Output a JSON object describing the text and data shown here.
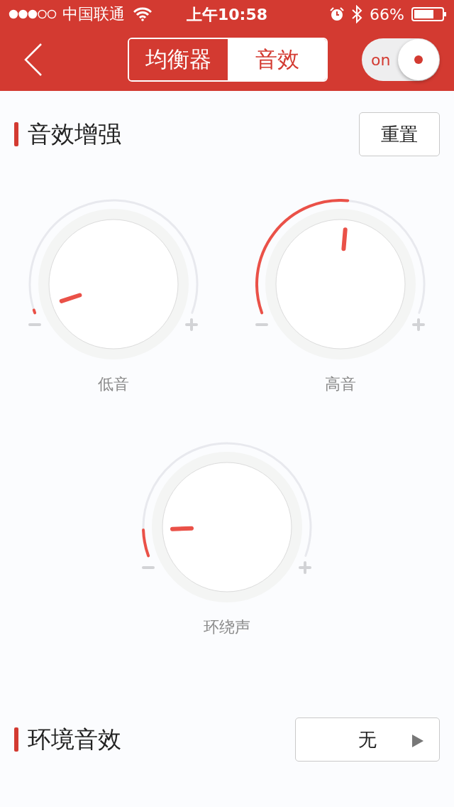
{
  "status_bar": {
    "carrier": "中国联通",
    "time": "上午10:58",
    "battery": "66%"
  },
  "nav": {
    "tabs": [
      {
        "label": "均衡器",
        "selected": false
      },
      {
        "label": "音效",
        "selected": true
      }
    ],
    "toggle": {
      "label": "on",
      "on": true
    }
  },
  "enhance": {
    "title": "音效增强",
    "reset": "重置",
    "knobs": [
      {
        "label": "低音"
      },
      {
        "label": "高音"
      },
      {
        "label": "环绕声"
      }
    ]
  },
  "ambience": {
    "title": "环境音效",
    "value": "无"
  }
}
